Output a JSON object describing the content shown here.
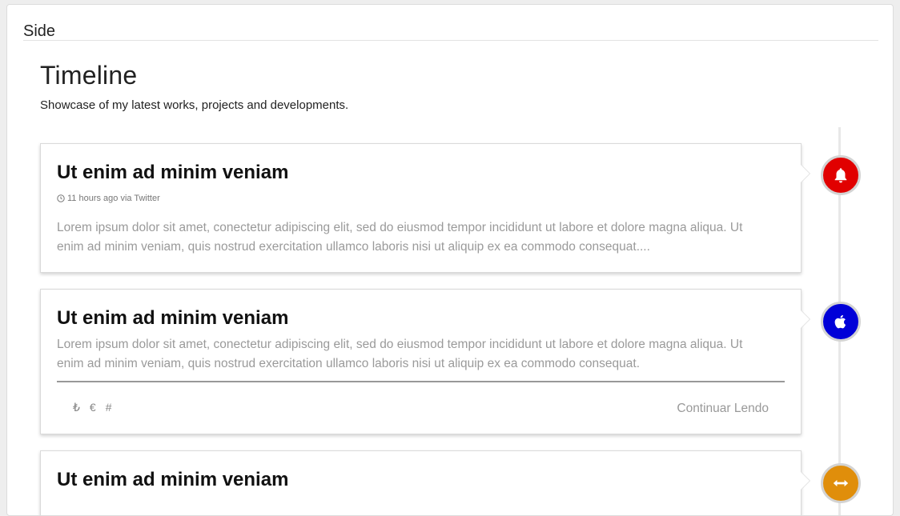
{
  "side": {
    "label": "Side"
  },
  "page": {
    "title": "Timeline",
    "subtitle": "Showcase of my latest works, projects and developments."
  },
  "items": [
    {
      "title": "Ut enim ad minim veniam",
      "meta": "11 hours ago via Twitter",
      "text": "Lorem ipsum dolor sit amet, conectetur adipiscing elit, sed do eiusmod tempor incididunt ut labore et dolore magna aliqua. Ut enim ad minim veniam, quis nostrud exercitation ullamco laboris nisi ut aliquip ex ea commodo consequat....",
      "badge_icon": "bell-icon",
      "badge_color": "#e10000"
    },
    {
      "title": "Ut enim ad minim veniam",
      "text": "Lorem ipsum dolor sit amet, conectetur adipiscing elit, sed do eiusmod tempor incididunt ut labore et dolore magna aliqua. Ut enim ad minim veniam, quis nostrud exercitation ullamco laboris nisi ut aliquip ex ea commodo consequat.",
      "footer_icons": [
        "₺",
        "€",
        "#"
      ],
      "footer_link": "Continuar Lendo",
      "badge_icon": "apple-icon",
      "badge_color": "#0000d8"
    },
    {
      "title": "Ut enim ad minim veniam",
      "badge_icon": "horizontal-arrows-icon",
      "badge_color": "#e08e0b"
    }
  ]
}
